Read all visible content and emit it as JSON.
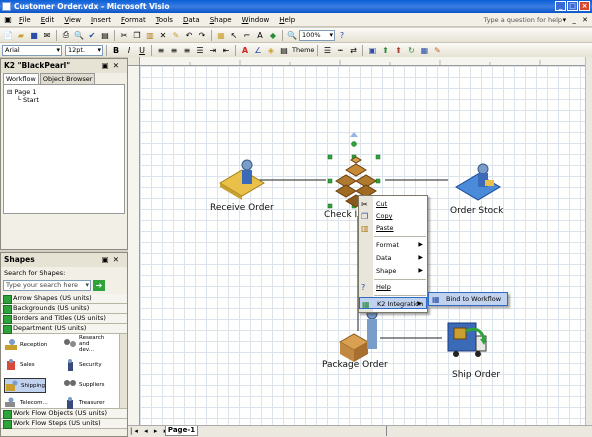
{
  "window": {
    "title": "Customer Order.vdx - Microsoft Visio",
    "controls": [
      "_",
      "□",
      "×"
    ]
  },
  "menu": {
    "items": [
      "File",
      "Edit",
      "View",
      "Insert",
      "Format",
      "Tools",
      "Data",
      "Shape",
      "Window",
      "Help"
    ],
    "help_placeholder": "Type a question for help"
  },
  "toolbar": {
    "zoom": "100%",
    "font": "Arial",
    "size": "12pt.",
    "theme_label": "Theme"
  },
  "k2_panel": {
    "title": "K2 \"BlackPearl\"",
    "tabs": [
      "Workflow",
      "Object Browser"
    ],
    "tree": {
      "root": "Page 1",
      "child": "Start"
    }
  },
  "shapes_panel": {
    "title": "Shapes",
    "search_label": "Search for Shapes:",
    "search_placeholder": "Type your search here",
    "stencils_top": [
      "Arrow Shapes (US units)",
      "Backgrounds (US units)",
      "Borders and Titles (US units)",
      "Department (US units)"
    ],
    "grid": [
      {
        "label": "Reception"
      },
      {
        "label": "Research and dev..."
      },
      {
        "label": "Sales"
      },
      {
        "label": "Security"
      },
      {
        "label": "Shipping"
      },
      {
        "label": "Suppliers"
      },
      {
        "label": "Telecom..."
      },
      {
        "label": "Treasurer"
      }
    ],
    "stencils_bottom": [
      "Work Flow Objects (US units)",
      "Work Flow Steps (US units)"
    ]
  },
  "diagram": {
    "receive": "Receive Order",
    "check": "Check In",
    "stock": "Order Stock",
    "package": "Package Order",
    "ship": "Ship Order"
  },
  "context_menu": {
    "items": [
      "Cut",
      "Copy",
      "Paste",
      "Format",
      "Data",
      "Shape",
      "Help",
      "K2 Integration"
    ],
    "submenu": "Bind to Workflow"
  },
  "status": {
    "page_tab": "Page-1"
  },
  "colors": {
    "accent": "#0a5fd6",
    "highlight": "#c1d2ee"
  }
}
